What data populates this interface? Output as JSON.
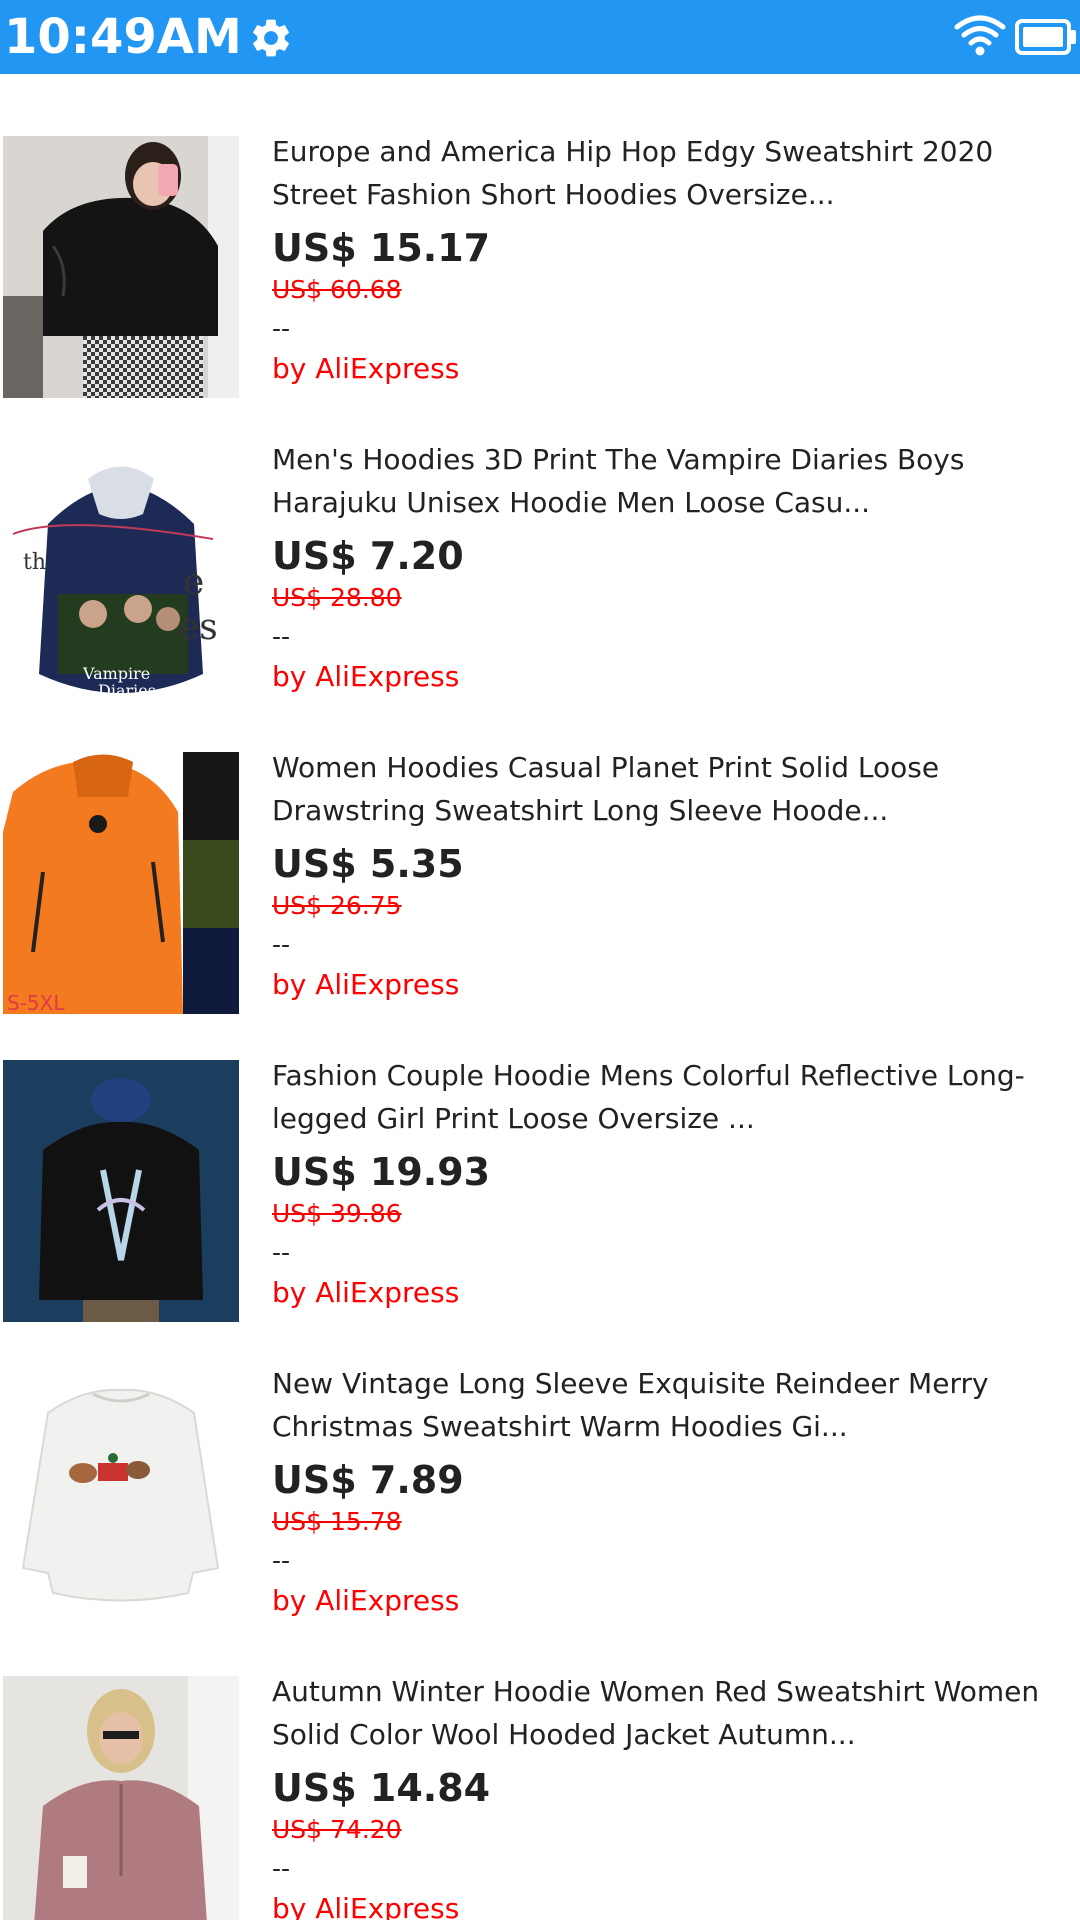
{
  "status_bar": {
    "time": "10:49AM",
    "background_color": "#2196f3",
    "icons": [
      "gear-icon",
      "wifi-icon",
      "battery-icon"
    ]
  },
  "products": [
    {
      "title_line1": "Europe and America Hip Hop Edgy Sweatshirt 2020",
      "title_line2": "Street Fashion Short Hoodies Oversize...",
      "price": "US$ 15.17",
      "original_price": "US$ 60.68",
      "rating": "--",
      "seller": "by AliExpress"
    },
    {
      "title_line1": "Men's Hoodies 3D Print The Vampire Diaries Boys",
      "title_line2": "Harajuku Unisex Hoodie Men Loose Casu...",
      "price": "US$ 7.20",
      "original_price": "US$ 28.80",
      "rating": "--",
      "seller": "by AliExpress",
      "image_text": "Vampire Diaries"
    },
    {
      "title_line1": "Women Hoodies Casual Planet Print Solid Loose",
      "title_line2": "Drawstring Sweatshirt Long Sleeve Hoode...",
      "price": "US$ 5.35",
      "original_price": "US$ 26.75",
      "rating": "--",
      "seller": "by AliExpress",
      "image_text": "S-5XL"
    },
    {
      "title_line1": "Fashion Couple Hoodie Mens Colorful Reflective Long-",
      "title_line2": "legged Girl Print Loose Oversize ...",
      "price": "US$ 19.93",
      "original_price": "US$ 39.86",
      "rating": "--",
      "seller": "by AliExpress"
    },
    {
      "title_line1": "New Vintage Long Sleeve Exquisite Reindeer Merry",
      "title_line2": "Christmas Sweatshirt Warm Hoodies Gi...",
      "price": "US$ 7.89",
      "original_price": "US$ 15.78",
      "rating": "--",
      "seller": "by AliExpress"
    },
    {
      "title_line1": "Autumn Winter Hoodie Women Red Sweatshirt Women",
      "title_line2": "Solid Color Wool Hooded Jacket Autumn...",
      "price": "US$ 14.84",
      "original_price": "US$ 74.20",
      "rating": "--",
      "seller": "by AliExpress"
    }
  ],
  "colors": {
    "price_text": "#222222",
    "discount_red": "#ff0000",
    "seller_red": "#ff0000"
  }
}
